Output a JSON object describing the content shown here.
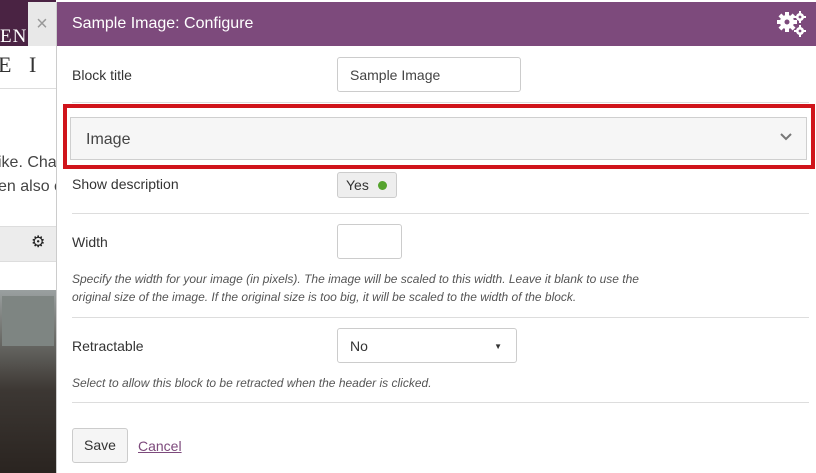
{
  "background": {
    "logo_text": "EN",
    "logo_text2": "E I",
    "text_line1": "ike. Cha",
    "text_line2": "en also c",
    "close_glyph": "×"
  },
  "modal": {
    "title": "Sample Image: Configure"
  },
  "form": {
    "block_title": {
      "label": "Block title",
      "value": "Sample Image"
    },
    "image_section": {
      "label": "Image"
    },
    "show_description": {
      "label": "Show description",
      "value": "Yes"
    },
    "width": {
      "label": "Width",
      "value": "",
      "help": "Specify the width for your image (in pixels). The image will be scaled to this width. Leave it blank to use the original size of the image. If the original size is too big, it will be scaled to the width of the block."
    },
    "retractable": {
      "label": "Retractable",
      "value": "No",
      "help": "Select to allow this block to be retracted when the header is clicked."
    }
  },
  "buttons": {
    "save_label": "Save",
    "cancel_label": "Cancel"
  },
  "colors": {
    "header": "#7d4a7c",
    "highlight": "#d0141b",
    "toggle_on": "#55a32e"
  },
  "icons": {
    "header": "gears-icon",
    "section_toggle": "chevron-down-icon",
    "background_settings": "gear-icon"
  }
}
